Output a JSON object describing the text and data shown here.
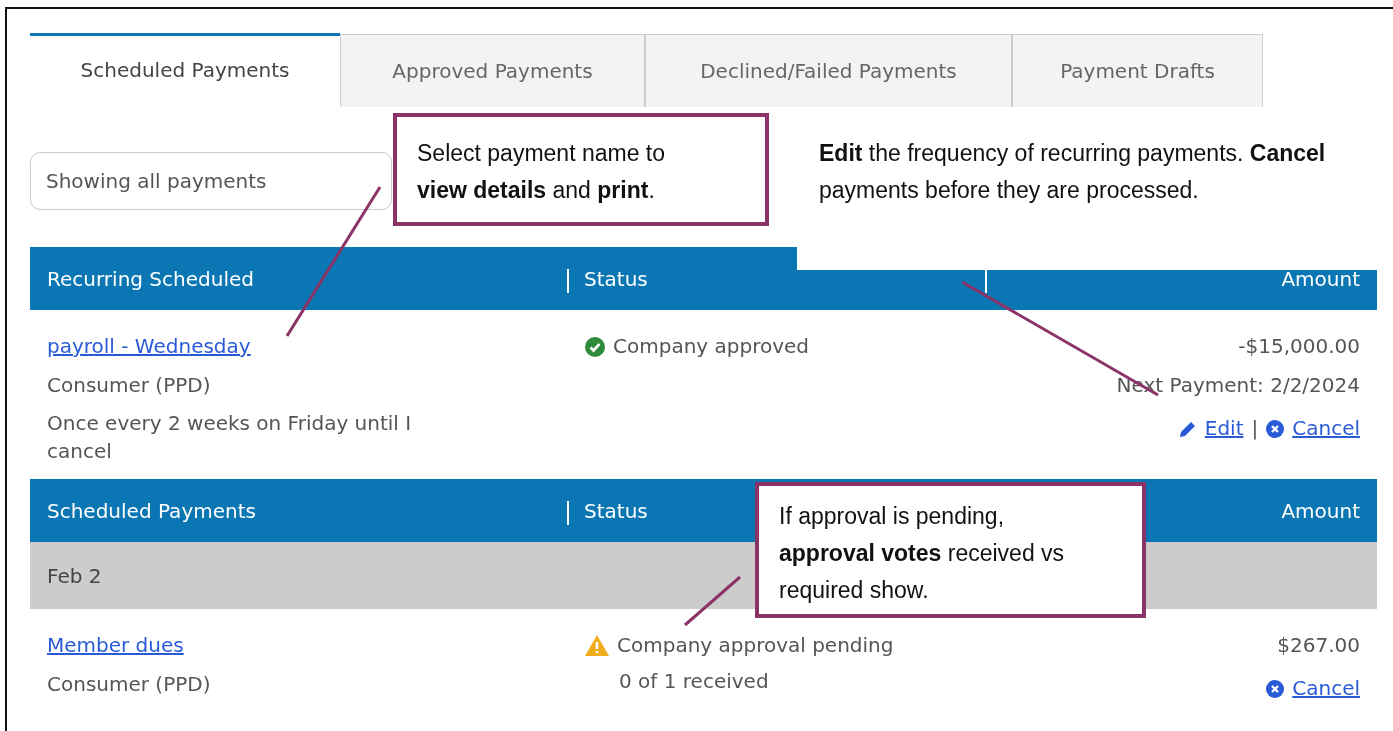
{
  "tabs": [
    {
      "label": "Scheduled Payments",
      "selected": true
    },
    {
      "label": "Approved Payments",
      "selected": false
    },
    {
      "label": "Declined/Failed Payments",
      "selected": false
    },
    {
      "label": "Payment Drafts",
      "selected": false
    }
  ],
  "filter": {
    "value": "Showing all payments"
  },
  "sections": [
    {
      "columns": [
        "Recurring Scheduled",
        "Status",
        "Amount"
      ],
      "rows": [
        {
          "kind": "payment",
          "name": "payroll - Wednesday",
          "type": "Consumer (PPD)",
          "schedule": "Once every 2 weeks on Friday until I cancel",
          "status": {
            "kind": "approved",
            "text": "Company approved"
          },
          "amount": "-$15,000.00",
          "next_payment": "Next Payment: 2/2/2024",
          "action_separator": "|",
          "actions": [
            {
              "kind": "edit",
              "label": "Edit"
            },
            {
              "kind": "cancel",
              "label": "Cancel"
            }
          ]
        }
      ]
    },
    {
      "columns": [
        "Scheduled Payments",
        "Status",
        "Amount"
      ],
      "rows": [
        {
          "kind": "date",
          "label": "Feb 2"
        },
        {
          "kind": "payment",
          "name": "Member dues",
          "type": "Consumer (PPD)",
          "status": {
            "kind": "pending",
            "text": "Company approval pending",
            "detail": "0 of 1 received"
          },
          "amount": "$267.00",
          "actions": [
            {
              "kind": "cancel",
              "label": "Cancel"
            }
          ]
        }
      ]
    }
  ],
  "callouts": [
    {
      "text": "Select payment name to **view details** and **print**.",
      "bordered": true
    },
    {
      "text": "**Edit** the frequency of recurring payments. **Cancel** payments before they are processed.",
      "bordered": false
    },
    {
      "text": "If approval is pending, **approval votes** received vs required show.",
      "bordered": true
    }
  ]
}
